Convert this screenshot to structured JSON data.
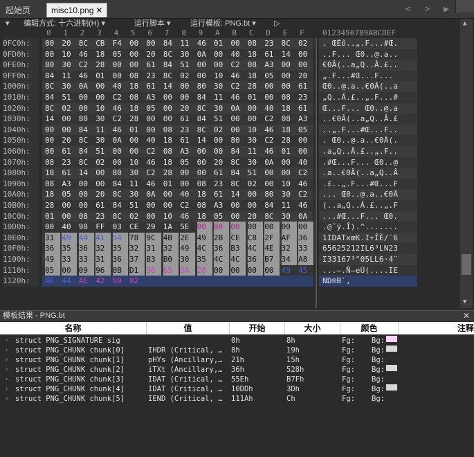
{
  "tabs": {
    "start": "起始页",
    "active_file": "misc10.png",
    "close": "✕",
    "arrows": "< > ▶"
  },
  "toolbar": {
    "menu_icon": "▾",
    "edit_mode": "编辑方式: 十六进制(H) ▾",
    "run_script": "运行脚本 ▾",
    "run_template": "运行模板: PNG.bt ▾",
    "play": "▷"
  },
  "column_header": {
    "hex": [
      "0",
      "1",
      "2",
      "3",
      "4",
      "5",
      "6",
      "7",
      "8",
      "9",
      "A",
      "B",
      "C",
      "D",
      "E",
      "F"
    ],
    "ascii": "0123456789ABCDEF"
  },
  "hex_rows": [
    {
      "addr": "0FC0h:",
      "bytes": [
        "00",
        "20",
        "8C",
        "CB",
        "F4",
        "00",
        "00",
        "84",
        "11",
        "46",
        "01",
        "00",
        "08",
        "23",
        "8C",
        "02"
      ],
      "ascii": ". ŒËô..„.F...#Œ."
    },
    {
      "addr": "0FD0h:",
      "bytes": [
        "00",
        "10",
        "46",
        "18",
        "05",
        "00",
        "20",
        "8C",
        "30",
        "0A",
        "00",
        "40",
        "18",
        "61",
        "14",
        "00"
      ],
      "ascii": "..F... Œ0..@.a.."
    },
    {
      "addr": "0FE0h:",
      "bytes": [
        "80",
        "30",
        "C2",
        "28",
        "00",
        "00",
        "61",
        "84",
        "51",
        "00",
        "00",
        "C2",
        "08",
        "A3",
        "00",
        "00"
      ],
      "ascii": "€0Â(..a„Q..Â.£.."
    },
    {
      "addr": "0FF0h:",
      "bytes": [
        "84",
        "11",
        "46",
        "01",
        "00",
        "08",
        "23",
        "8C",
        "02",
        "00",
        "10",
        "46",
        "18",
        "05",
        "00",
        "20"
      ],
      "ascii": "„.F...#Œ...F... "
    },
    {
      "addr": "1000h:",
      "bytes": [
        "8C",
        "30",
        "0A",
        "00",
        "40",
        "18",
        "61",
        "14",
        "00",
        "80",
        "30",
        "C2",
        "28",
        "00",
        "00",
        "61"
      ],
      "ascii": "Œ0..@.a..€0Â(..a"
    },
    {
      "addr": "1010h:",
      "bytes": [
        "84",
        "51",
        "00",
        "00",
        "C2",
        "08",
        "A3",
        "00",
        "00",
        "84",
        "11",
        "46",
        "01",
        "00",
        "08",
        "23"
      ],
      "ascii": "„Q..Â.£..„.F...#"
    },
    {
      "addr": "1020h:",
      "bytes": [
        "8C",
        "02",
        "00",
        "10",
        "46",
        "18",
        "05",
        "00",
        "20",
        "8C",
        "30",
        "0A",
        "00",
        "40",
        "18",
        "61"
      ],
      "ascii": "Œ...F... Œ0..@.a"
    },
    {
      "addr": "1030h:",
      "bytes": [
        "14",
        "00",
        "80",
        "30",
        "C2",
        "28",
        "00",
        "00",
        "61",
        "84",
        "51",
        "00",
        "00",
        "C2",
        "08",
        "A3"
      ],
      "ascii": "..€0Â(..a„Q..Â.£"
    },
    {
      "addr": "1040h:",
      "bytes": [
        "00",
        "00",
        "84",
        "11",
        "46",
        "01",
        "00",
        "08",
        "23",
        "8C",
        "02",
        "00",
        "10",
        "46",
        "18",
        "05"
      ],
      "ascii": "..„.F...#Œ...F.."
    },
    {
      "addr": "1050h:",
      "bytes": [
        "00",
        "20",
        "8C",
        "30",
        "0A",
        "00",
        "40",
        "18",
        "61",
        "14",
        "00",
        "80",
        "30",
        "C2",
        "28",
        "00"
      ],
      "ascii": ". Œ0..@.a..€0Â(."
    },
    {
      "addr": "1060h:",
      "bytes": [
        "00",
        "61",
        "84",
        "51",
        "00",
        "00",
        "C2",
        "08",
        "A3",
        "00",
        "00",
        "84",
        "11",
        "46",
        "01",
        "00"
      ],
      "ascii": ".a„Q..Â.£..„.F.."
    },
    {
      "addr": "1070h:",
      "bytes": [
        "08",
        "23",
        "8C",
        "02",
        "00",
        "10",
        "46",
        "18",
        "05",
        "00",
        "20",
        "8C",
        "30",
        "0A",
        "00",
        "40"
      ],
      "ascii": ".#Œ...F... Œ0..@"
    },
    {
      "addr": "1080h:",
      "bytes": [
        "18",
        "61",
        "14",
        "00",
        "80",
        "30",
        "C2",
        "28",
        "00",
        "00",
        "61",
        "84",
        "51",
        "00",
        "00",
        "C2"
      ],
      "ascii": ".a..€0Â(..a„Q..Â"
    },
    {
      "addr": "1090h:",
      "bytes": [
        "08",
        "A3",
        "00",
        "00",
        "84",
        "11",
        "46",
        "01",
        "00",
        "08",
        "23",
        "8C",
        "02",
        "00",
        "10",
        "46"
      ],
      "ascii": ".£..„.F...#Œ...F"
    },
    {
      "addr": "10A0h:",
      "bytes": [
        "18",
        "05",
        "00",
        "20",
        "8C",
        "30",
        "0A",
        "00",
        "40",
        "18",
        "61",
        "14",
        "00",
        "80",
        "30",
        "C2"
      ],
      "ascii": "... Œ0..@.a..€0Â"
    },
    {
      "addr": "10B0h:",
      "bytes": [
        "28",
        "00",
        "00",
        "61",
        "84",
        "51",
        "00",
        "00",
        "C2",
        "08",
        "A3",
        "00",
        "00",
        "84",
        "11",
        "46"
      ],
      "ascii": "(..a„Q..Â.£..„.F"
    },
    {
      "addr": "10C0h:",
      "bytes": [
        "01",
        "00",
        "08",
        "23",
        "8C",
        "02",
        "00",
        "10",
        "46",
        "18",
        "05",
        "00",
        "20",
        "8C",
        "30",
        "0A"
      ],
      "ascii": "...#Œ...F... Œ0."
    },
    {
      "addr": "10D0h:",
      "bytes": [
        "00",
        "40",
        "98",
        "FF",
        "03",
        "CE",
        "29",
        "1A",
        "5E",
        "00",
        "00",
        "00",
        "00",
        "00",
        "00",
        "00"
      ],
      "ascii": ".@˜ÿ.Î).^......."
    },
    {
      "addr": "10E0h:",
      "bytes": [
        "31",
        "49",
        "44",
        "41",
        "54",
        "78",
        "9C",
        "4B",
        "2E",
        "49",
        "2B",
        "CE",
        "C8",
        "2F",
        "AF",
        "36"
      ],
      "ascii": "1IDATxœK.I+ÎÈ/¯6"
    },
    {
      "addr": "10F0h:",
      "bytes": [
        "36",
        "35",
        "36",
        "32",
        "35",
        "32",
        "31",
        "32",
        "49",
        "4C",
        "36",
        "B3",
        "4C",
        "4E",
        "32",
        "33"
      ],
      "ascii": "65625212IL6³LN23"
    },
    {
      "addr": "1100h:",
      "bytes": [
        "49",
        "33",
        "33",
        "31",
        "36",
        "37",
        "B3",
        "B0",
        "30",
        "35",
        "4C",
        "4C",
        "36",
        "B7",
        "34",
        "A8"
      ],
      "ascii": "I33167³°05LL6·4¨"
    },
    {
      "addr": "1110h:",
      "bytes": [
        "05",
        "00",
        "09",
        "96",
        "0B",
        "D1",
        "96",
        "65",
        "DA",
        "28",
        "00",
        "00",
        "00",
        "00",
        "49",
        "45"
      ],
      "ascii": "...–.Ñ–eÚ(....IE"
    },
    {
      "addr": "1120h:",
      "bytes": [
        "4E",
        "44",
        "AE",
        "42",
        "60",
        "82",
        "",
        "",
        "",
        "",
        "",
        "",
        "",
        "",
        "",
        ""
      ],
      "ascii": "ND®B`‚"
    }
  ],
  "template_panel": {
    "title": "模板结果 - PNG.bt",
    "close": "✕",
    "headers": [
      "名称",
      "值",
      "开始",
      "大小",
      "颜色",
      "注释"
    ],
    "rows": [
      {
        "name": "struct PNG_SIGNATURE sig",
        "value": "",
        "start": "0h",
        "size": "8h",
        "fg": "Fg:",
        "bg": "Bg:",
        "bg_color": "#ffd0ff"
      },
      {
        "name": "struct PNG_CHUNK chunk[0]",
        "value": "IHDR  (Critical, …",
        "start": "8h",
        "size": "19h",
        "fg": "Fg:",
        "bg": "Bg:",
        "bg_color": "#d8d8d8"
      },
      {
        "name": "struct PNG_CHUNK chunk[1]",
        "value": "pHYs  (Ancillary,…",
        "start": "21h",
        "size": "15h",
        "fg": "Fg:",
        "bg": "Bg:",
        "bg_color": ""
      },
      {
        "name": "struct PNG_CHUNK chunk[2]",
        "value": "iTXt  (Ancillary,…",
        "start": "36h",
        "size": "528h",
        "fg": "Fg:",
        "bg": "Bg:",
        "bg_color": "#d8d8d8"
      },
      {
        "name": "struct PNG_CHUNK chunk[3]",
        "value": "IDAT  (Critical, …",
        "start": "55Eh",
        "size": "B7Fh",
        "fg": "Fg:",
        "bg": "Bg:",
        "bg_color": ""
      },
      {
        "name": "struct PNG_CHUNK chunk[4]",
        "value": "IDAT  (Critical, …",
        "start": "10DDh",
        "size": "3Dh",
        "fg": "Fg:",
        "bg": "Bg:",
        "bg_color": "#d8d8d8"
      },
      {
        "name": "struct PNG_CHUNK chunk[5]",
        "value": "IEND  (Critical, …",
        "start": "111Ah",
        "size": "Ch",
        "fg": "Fg:",
        "bg": "Bg:",
        "bg_color": ""
      }
    ]
  },
  "colors": {
    "accent_selection": "#9a9a9a",
    "magenta_bytes": "#c040c0",
    "blue_bytes": "#4a60d8",
    "cursor_row": "#2f3f6a"
  }
}
